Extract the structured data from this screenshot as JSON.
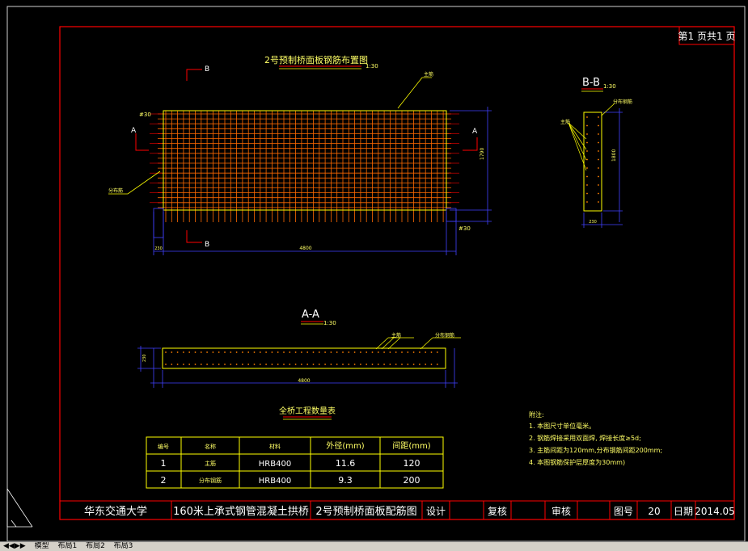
{
  "drawing": {
    "page_label": "第1 页共1 页",
    "plan_title": "2号预制桥面板钢筋布置图",
    "plan_scale": "1:30",
    "section_bb_title": "B-B",
    "section_bb_scale": "1:30",
    "section_aa_title": "A-A",
    "section_aa_scale": "1:30",
    "section_marks": {
      "b_top": "B",
      "b_bottom": "B",
      "a_left": "A",
      "a_right": "A"
    },
    "spacing_tl": "#30",
    "spacing_br": "#30",
    "dim_width": "4800",
    "dim_height": "1790",
    "dim_side": "230",
    "dim_aa_width": "4800",
    "dim_aa_height": "230",
    "dim_bb_width": "230",
    "dim_bb_height": "1800",
    "callouts": {
      "plan_top": "主筋",
      "plan_left": "分布筋",
      "bb_left": "主筋",
      "bb_top": "分布钢筋",
      "aa_main": "主筋",
      "aa_dist": "分布钢筋"
    }
  },
  "quantity_table": {
    "title": "全桥工程数量表",
    "headers": [
      "编号",
      "名称",
      "材料",
      "外径(mm)",
      "间距(mm)"
    ],
    "rows": [
      [
        "1",
        "主筋",
        "HRB400",
        "11.6",
        "120"
      ],
      [
        "2",
        "分布钢筋",
        "HRB400",
        "9.3",
        "200"
      ]
    ]
  },
  "notes": {
    "heading": "附注:",
    "items": [
      "1. 本图尺寸单位毫米。",
      "2. 钢筋焊接采用双面焊, 焊接长度≥5d;",
      "3. 主筋间距为120mm,分布钢筋间距200mm;",
      "4. 本图钢筋保护层厚度为30mm)"
    ]
  },
  "title_block": {
    "school": "华东交通大学",
    "project": "160米上承式钢管混凝土拱桥",
    "drawing_name": "2号预制桥面板配筋图",
    "design_label": "设计",
    "check_label": "复核",
    "review_label": "审核",
    "drawing_no_label": "图号",
    "drawing_no": "20",
    "date_label": "日期",
    "date": "2014.05"
  },
  "status_tabs": [
    "模型",
    "布局1",
    "布局2",
    "布局3"
  ],
  "colors": {
    "background": "#000000",
    "frame": "#ff0000",
    "rebar": "#ff8000",
    "outline": "#ffff00",
    "dimension": "#0000ff",
    "text": "#ffff66"
  }
}
